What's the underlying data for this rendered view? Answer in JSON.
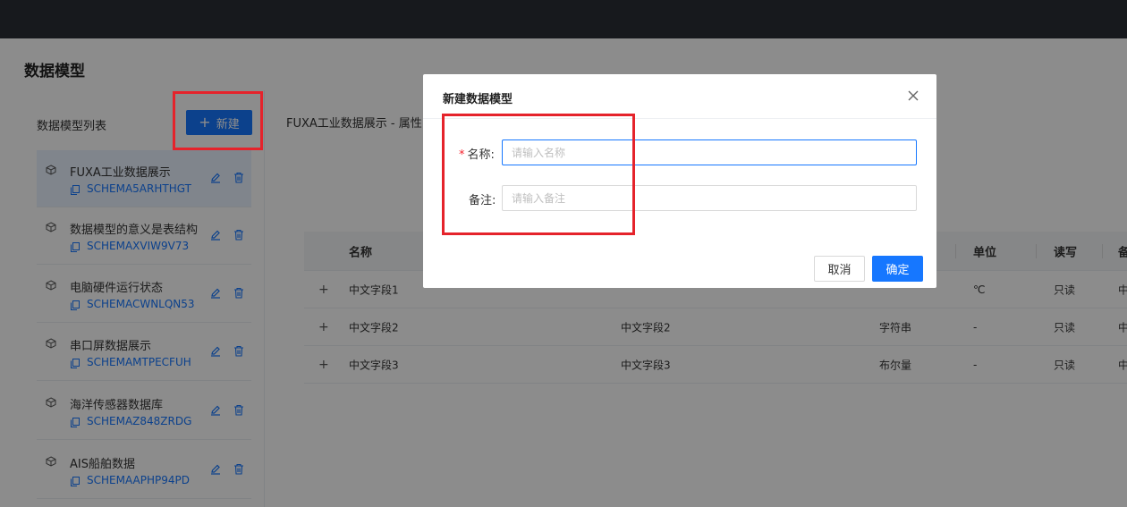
{
  "page": {
    "title": "数据模型"
  },
  "sidebar": {
    "title": "数据模型列表",
    "add_label": "新建",
    "items": [
      {
        "name": "FUXA工业数据展示",
        "code": "SCHEMA5ARHTHGT"
      },
      {
        "name": "数据模型的意义是表结构",
        "code": "SCHEMAXVIW9V73"
      },
      {
        "name": "电脑硬件运行状态",
        "code": "SCHEMACWNLQN53"
      },
      {
        "name": "串口屏数据展示",
        "code": "SCHEMAMTPECFUH"
      },
      {
        "name": "海洋传感器数据库",
        "code": "SCHEMAZ848ZRDG"
      },
      {
        "name": "AIS船舶数据",
        "code": "SCHEMAAPHP94PD"
      }
    ]
  },
  "main": {
    "title": "FUXA工业数据展示 - 属性",
    "table": {
      "headers": {
        "name": "名称",
        "unit": "单位",
        "rw": "读写",
        "extra": "备"
      },
      "rows": [
        {
          "expand": "+",
          "name": "中文字段1",
          "alias": "",
          "type": "",
          "unit": "℃",
          "rw": "只读",
          "extra": "中"
        },
        {
          "expand": "+",
          "name": "中文字段2",
          "alias": "中文字段2",
          "type": "字符串",
          "unit": "-",
          "rw": "只读",
          "extra": "中"
        },
        {
          "expand": "+",
          "name": "中文字段3",
          "alias": "中文字段3",
          "type": "布尔量",
          "unit": "-",
          "rw": "只读",
          "extra": "中"
        }
      ]
    }
  },
  "modal": {
    "title": "新建数据模型",
    "name_label": "名称:",
    "name_required": "*",
    "name_placeholder": "请输入名称",
    "remark_label": "备注:",
    "remark_placeholder": "请输入备注",
    "cancel_label": "取消",
    "ok_label": "确定"
  },
  "colors": {
    "primary": "#1677ff",
    "highlight": "#e5232b",
    "topbar": "#2b2e36"
  }
}
